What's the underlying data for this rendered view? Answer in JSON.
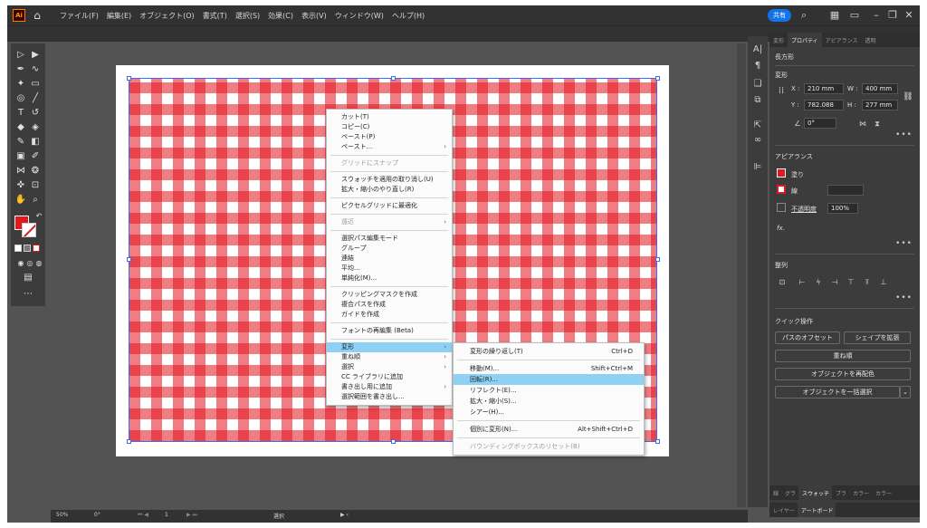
{
  "app": {
    "logo": "Ai",
    "menu": [
      "ファイル(F)",
      "編集(E)",
      "オブジェクト(O)",
      "書式(T)",
      "選択(S)",
      "効果(C)",
      "表示(V)",
      "ウィンドウ(W)",
      "ヘルプ(H)"
    ],
    "share_label": "共有",
    "icons": [
      "home-icon",
      "search-icon",
      "arrange-documents-icon",
      "workspace-icon",
      "minimize-icon",
      "restore-icon",
      "close-icon"
    ]
  },
  "context_menu": {
    "items": [
      {
        "label": "カット(T)"
      },
      {
        "label": "コピー(C)"
      },
      {
        "label": "ペースト(P)"
      },
      {
        "label": "ペースト...",
        "arrow": "›"
      },
      {
        "sep": true
      },
      {
        "label": "グリッドにスナップ",
        "disabled": true
      },
      {
        "sep": true
      },
      {
        "label": "スウォッチを適用の取り消し(U)"
      },
      {
        "label": "拡大・縮小のやり直し(R)"
      },
      {
        "sep": true
      },
      {
        "label": "ピクセルグリッドに最適化"
      },
      {
        "sep": true
      },
      {
        "label": "遠近",
        "arrow": "›",
        "disabled": true
      },
      {
        "sep": true
      },
      {
        "label": "選択パス編集モード"
      },
      {
        "label": "グループ"
      },
      {
        "label": "連結"
      },
      {
        "label": "平均..."
      },
      {
        "label": "単純化(M)..."
      },
      {
        "sep": true
      },
      {
        "label": "クリッピングマスクを作成"
      },
      {
        "label": "複合パスを作成"
      },
      {
        "label": "ガイドを作成"
      },
      {
        "sep": true
      },
      {
        "label": "フォントの再編集 (Beta)"
      },
      {
        "sep": true
      },
      {
        "label": "変形",
        "arrow": "›",
        "active": true
      },
      {
        "label": "重ね順",
        "arrow": "›"
      },
      {
        "label": "選択",
        "arrow": "›"
      },
      {
        "label": "CC ライブラリに追加"
      },
      {
        "label": "書き出し用に追加",
        "arrow": "›"
      },
      {
        "label": "選択範囲を書き出し..."
      }
    ]
  },
  "submenu": {
    "items": [
      {
        "label": "変形の繰り返し(T)",
        "shortcut": "Ctrl+D"
      },
      {
        "sep": true
      },
      {
        "label": "移動(M)...",
        "shortcut": "Shift+Ctrl+M"
      },
      {
        "label": "回転(R)...",
        "active": true
      },
      {
        "label": "リフレクト(E)..."
      },
      {
        "label": "拡大・縮小(S)..."
      },
      {
        "label": "シアー(H)..."
      },
      {
        "sep": true
      },
      {
        "label": "個別に変形(N)...",
        "shortcut": "Alt+Shift+Ctrl+D"
      },
      {
        "sep": true
      },
      {
        "label": "バウンディングボックスのリセット(B)",
        "disabled": true
      }
    ]
  },
  "panel": {
    "tabs": [
      "変形",
      "プロパティ",
      "アピアランス",
      "透明"
    ],
    "active_tab": 1,
    "object_type": "長方形",
    "transform": {
      "title": "変形",
      "x_label": "X :",
      "x": "210 mm",
      "y_label": "Y :",
      "y": "782.088",
      "w_label": "W :",
      "w": "400 mm",
      "h_label": "H :",
      "h": "277 mm",
      "angle": "0°"
    },
    "appearance": {
      "title": "アピアランス",
      "fill_label": "塗り",
      "stroke_label": "線",
      "opacity_label": "不透明度",
      "opacity": "100%",
      "fx": "fx."
    },
    "align_title": "整列",
    "quick": {
      "title": "クイック操作",
      "offset_path": "パスのオフセット",
      "expand_shape": "シェイプを拡張",
      "arrange": "重ね順",
      "recolor": "オブジェクトを再配色",
      "select_same": "オブジェクトを一括選択"
    },
    "bottom_tabs": [
      "線",
      "グラ",
      "スウォッチ",
      "ブラ",
      "カラー",
      "カラー"
    ],
    "bottom_tabs2": [
      "レイヤー",
      "アートボード"
    ]
  },
  "status": {
    "zoom": "50%",
    "angle": "0°",
    "page": "1",
    "mode": "選択"
  },
  "colors": {
    "accent": "#e0191d",
    "selection": "#3b6ff0",
    "highlight": "#8fd1f5"
  }
}
